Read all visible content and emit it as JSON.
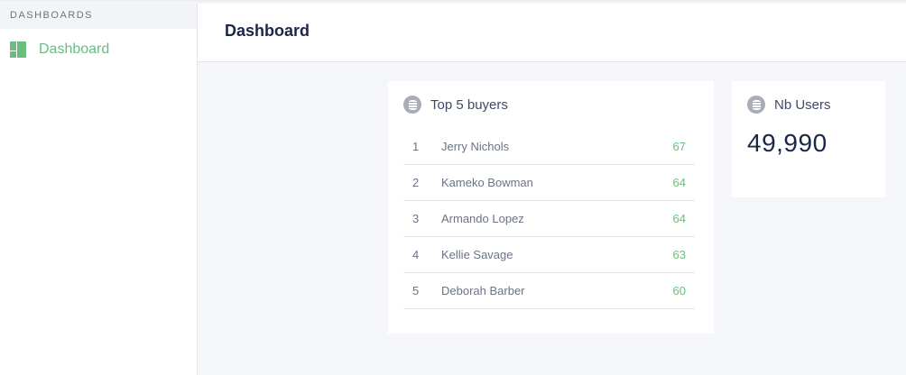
{
  "sidebar": {
    "section": "DASHBOARDS",
    "items": [
      {
        "label": "Dashboard"
      }
    ]
  },
  "header": {
    "title": "Dashboard"
  },
  "top_buyers": {
    "title": "Top 5 buyers",
    "rows": [
      {
        "rank": "1",
        "name": "Jerry Nichols",
        "value": "67"
      },
      {
        "rank": "2",
        "name": "Kameko Bowman",
        "value": "64"
      },
      {
        "rank": "3",
        "name": "Armando Lopez",
        "value": "64"
      },
      {
        "rank": "4",
        "name": "Kellie Savage",
        "value": "63"
      },
      {
        "rank": "5",
        "name": "Deborah Barber",
        "value": "60"
      }
    ]
  },
  "nb_users": {
    "title": "Nb Users",
    "value": "49,990"
  }
}
